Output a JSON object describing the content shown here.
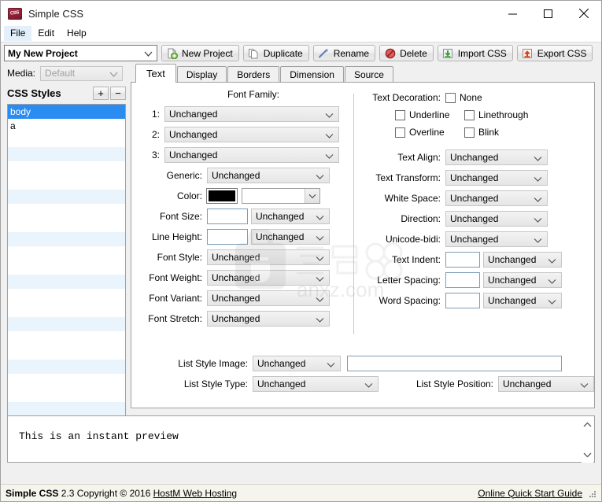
{
  "window": {
    "title": "Simple CSS",
    "app_icon": "css-app-icon",
    "minimize": "minimize-icon",
    "maximize": "maximize-icon",
    "close": "close-icon"
  },
  "menubar": {
    "items": [
      "File",
      "Edit",
      "Help"
    ]
  },
  "toolbar": {
    "project_value": "My New Project",
    "buttons": [
      {
        "label": "New Project",
        "icon": "new-project-icon"
      },
      {
        "label": "Duplicate",
        "icon": "duplicate-icon"
      },
      {
        "label": "Rename",
        "icon": "rename-pencil-icon"
      },
      {
        "label": "Delete",
        "icon": "delete-forbidden-icon"
      },
      {
        "label": "Import CSS",
        "icon": "import-down-arrow-icon"
      },
      {
        "label": "Export CSS",
        "icon": "export-up-arrow-icon"
      }
    ]
  },
  "sidebar": {
    "media_label": "Media:",
    "media_value": "Default",
    "styles_title": "CSS Styles",
    "add_label": "+",
    "remove_label": "−",
    "styles": [
      "body",
      "a"
    ]
  },
  "tabs": [
    {
      "label": "Text",
      "active": true
    },
    {
      "label": "Display",
      "active": false
    },
    {
      "label": "Borders",
      "active": false
    },
    {
      "label": "Dimension",
      "active": false
    },
    {
      "label": "Source",
      "active": false
    }
  ],
  "text_panel": {
    "font_family_heading": "Font Family:",
    "font_family_rows": [
      {
        "index": "1:",
        "value": "Unchanged"
      },
      {
        "index": "2:",
        "value": "Unchanged"
      },
      {
        "index": "3:",
        "value": "Unchanged"
      }
    ],
    "left_fields": [
      {
        "label": "Generic:",
        "value": "Unchanged"
      },
      {
        "label": "Font Weight:",
        "value": "Unchanged"
      },
      {
        "label": "Font Variant:",
        "value": "Unchanged"
      },
      {
        "label": "Font Stretch:",
        "value": "Unchanged"
      }
    ],
    "color": {
      "label": "Color:",
      "swatch": "#000000",
      "value": ""
    },
    "font_size": {
      "label": "Font Size:",
      "number": "",
      "value": "Unchanged"
    },
    "line_height": {
      "label": "Line Height:",
      "number": "",
      "value": "Unchanged"
    },
    "font_style": {
      "label": "Font Style:",
      "value": "Unchanged"
    },
    "text_decoration": {
      "label": "Text Decoration:",
      "options": [
        {
          "label": "None",
          "checked": false
        },
        {
          "label": "Underline",
          "checked": false
        },
        {
          "label": "Linethrough",
          "checked": false
        },
        {
          "label": "Overline",
          "checked": false
        },
        {
          "label": "Blink",
          "checked": false
        }
      ]
    },
    "right_fields": [
      {
        "label": "Text Align:",
        "value": "Unchanged"
      },
      {
        "label": "Text Transform:",
        "value": "Unchanged"
      },
      {
        "label": "White Space:",
        "value": "Unchanged"
      },
      {
        "label": "Direction:",
        "value": "Unchanged"
      },
      {
        "label": "Unicode-bidi:",
        "value": "Unchanged"
      }
    ],
    "right_spin_fields": [
      {
        "label": "Text Indent:",
        "number": "",
        "value": "Unchanged"
      },
      {
        "label": "Letter Spacing:",
        "number": "",
        "value": "Unchanged"
      },
      {
        "label": "Word Spacing:",
        "number": "",
        "value": "Unchanged"
      }
    ],
    "list_style_image": {
      "label": "List Style Image:",
      "value": "Unchanged",
      "url": ""
    },
    "list_style_type": {
      "label": "List Style Type:",
      "value": "Unchanged"
    },
    "list_style_position": {
      "label": "List Style Position:",
      "value": "Unchanged"
    }
  },
  "preview": {
    "text": "This is an instant preview"
  },
  "statusbar": {
    "app_name": "Simple CSS",
    "version_copyright": " 2.3 Copyright © 2016 ",
    "vendor_link": "HostM Web Hosting",
    "help_link": "Online Quick Start Guide"
  },
  "watermark": {
    "text": "anxz.com"
  },
  "colors": {
    "selection_blue": "#2a8cf0",
    "stripe_blue": "#eaf4fd",
    "panel_bg": "#f0f0f0",
    "status_bg": "#f5f5ee",
    "icon_red": "#8e1f36"
  }
}
